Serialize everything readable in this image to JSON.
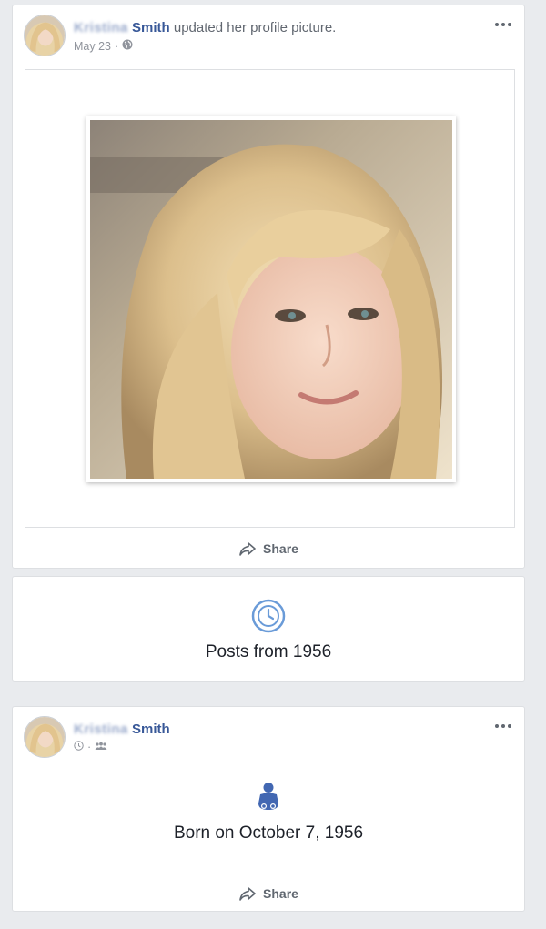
{
  "post1": {
    "author_first": "Kristina",
    "author_last": "Smith",
    "action": "updated her profile picture.",
    "date": "May 23",
    "separator": "·",
    "privacy_icon": "globe-icon",
    "share_label": "Share"
  },
  "posts_from": {
    "icon": "clock-icon",
    "label": "Posts from 1956"
  },
  "post2": {
    "author_first": "Kristina",
    "author_last": "Smith",
    "separator": "·",
    "privacy_icon": "friends-icon",
    "event_icon": "baby-icon",
    "event_label": "Born on October 7, 1956",
    "share_label": "Share"
  },
  "colors": {
    "link": "#385898",
    "accent": "#4267b2",
    "background": "#e9ebee"
  }
}
